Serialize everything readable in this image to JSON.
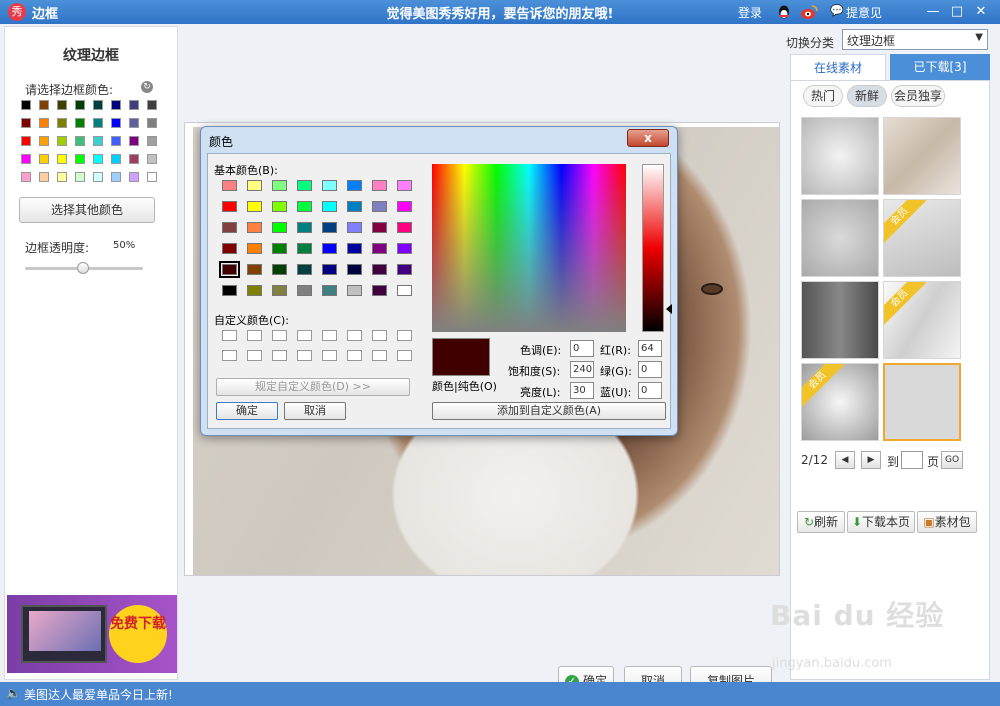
{
  "titlebar": {
    "app_title": "边框",
    "slogan": "觉得美图秀秀好用，要告诉您的朋友哦!",
    "login": "登录",
    "feedback": "提意见",
    "minimize": "—",
    "maximize": "□",
    "close": "✕"
  },
  "left_panel": {
    "title": "纹理边框",
    "color_label": "请选择边框颜色:",
    "swatches": [
      [
        "#000000",
        "#7f3f00",
        "#3f3f00",
        "#003f00",
        "#003f3f",
        "#00007f",
        "#3f3f7f",
        "#3f3f3f"
      ],
      [
        "#7f0000",
        "#ff7f00",
        "#7f7f00",
        "#007f00",
        "#007f7f",
        "#0000ff",
        "#5f5f9f",
        "#7f7f7f"
      ],
      [
        "#ff0000",
        "#ff9f00",
        "#9fcf00",
        "#3fbf7f",
        "#3fcfcf",
        "#3f5fff",
        "#7f007f",
        "#9f9f9f"
      ],
      [
        "#ff00ff",
        "#ffcf00",
        "#ffff00",
        "#00ff00",
        "#00ffff",
        "#00cfff",
        "#9f3f5f",
        "#c0c0c0"
      ],
      [
        "#ff9fcf",
        "#ffcf9f",
        "#ffff9f",
        "#cfffcf",
        "#cfffff",
        "#9fcfff",
        "#cf9fff",
        "#ffffff"
      ]
    ],
    "choose_other": "选择其他颜色",
    "opacity_label": "边框透明度:",
    "opacity_value": "50%",
    "ad_text": "免费下载"
  },
  "dialog": {
    "title": "颜色",
    "close": "x",
    "basic_colors_label": "基本颜色(B):",
    "basic_colors": [
      [
        "#ff8080",
        "#ffff80",
        "#80ff80",
        "#00ff80",
        "#80ffff",
        "#0080ff",
        "#ff80c0",
        "#ff80ff"
      ],
      [
        "#ff0000",
        "#ffff00",
        "#80ff00",
        "#00ff40",
        "#00ffff",
        "#0080c0",
        "#8080c0",
        "#ff00ff"
      ],
      [
        "#804040",
        "#ff8040",
        "#00ff00",
        "#008080",
        "#004080",
        "#8080ff",
        "#800040",
        "#ff0080"
      ],
      [
        "#800000",
        "#ff8000",
        "#008000",
        "#008040",
        "#0000ff",
        "#0000a0",
        "#800080",
        "#8000ff"
      ],
      [
        "#400000",
        "#804000",
        "#004000",
        "#004040",
        "#000080",
        "#000040",
        "#400040",
        "#400080"
      ],
      [
        "#000000",
        "#808000",
        "#808040",
        "#808080",
        "#408080",
        "#c0c0c0",
        "#400040",
        "#ffffff"
      ]
    ],
    "custom_colors_label": "自定义颜色(C):",
    "define_custom": "规定自定义颜色(D) >>",
    "ok": "确定",
    "cancel": "取消",
    "color_solid_label": "颜色|纯色(O)",
    "hue_label": "色调(E):",
    "hue": "0",
    "sat_label": "饱和度(S):",
    "sat": "240",
    "lum_label": "亮度(L):",
    "lum": "30",
    "red_label": "红(R):",
    "red": "64",
    "green_label": "绿(G):",
    "green": "0",
    "blue_label": "蓝(U):",
    "blue": "0",
    "add_custom": "添加到自定义颜色(A)",
    "current_color": "#400000"
  },
  "right_panel": {
    "category_label": "切换分类",
    "category_value": "纹理边框",
    "tab_online": "在线素材",
    "tab_downloaded": "已下载[3]",
    "chip_hot": "热门",
    "chip_new": "新鲜",
    "chip_vip": "会员独享",
    "vip_ribbon": "会员",
    "page_current": "2/12",
    "goto_label": "到",
    "page_unit": "页",
    "go": "GO",
    "refresh": "刷新",
    "download_page": "下载本页",
    "material_pack": "素材包"
  },
  "actions": {
    "ok": "确定",
    "cancel": "取消",
    "copy_image": "复制图片"
  },
  "status": {
    "message": "美图达人最爱单品今日上新!"
  },
  "watermark": {
    "brand": "Bai du 经验",
    "url": "jingyan.baidu.com"
  }
}
